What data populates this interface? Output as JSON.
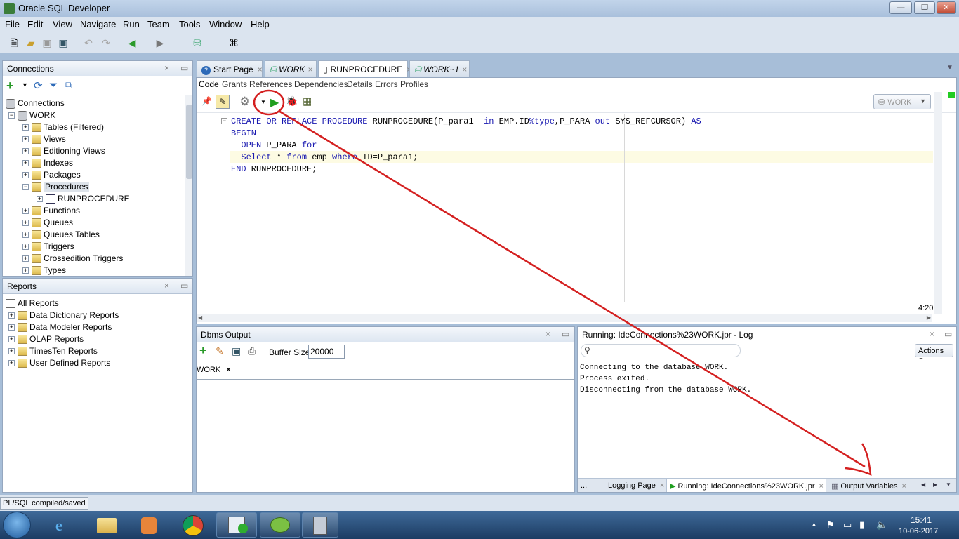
{
  "window": {
    "title": "Oracle SQL Developer"
  },
  "menu": [
    "File",
    "Edit",
    "View",
    "Navigate",
    "Run",
    "Team",
    "Tools",
    "Window",
    "Help"
  ],
  "connections": {
    "panel_title": "Connections",
    "root": "Connections",
    "connection": "WORK",
    "items": [
      "Tables (Filtered)",
      "Views",
      "Editioning Views",
      "Indexes",
      "Packages",
      "Procedures",
      "RUNPROCEDURE",
      "Functions",
      "Queues",
      "Queues Tables",
      "Triggers",
      "Crossedition Triggers",
      "Types"
    ]
  },
  "reports": {
    "panel_title": "Reports",
    "items": [
      "All Reports",
      "Data Dictionary Reports",
      "Data Modeler Reports",
      "OLAP Reports",
      "TimesTen Reports",
      "User Defined Reports"
    ]
  },
  "editor": {
    "tabs": [
      "Start Page",
      "WORK",
      "RUNPROCEDURE",
      "WORK~1"
    ],
    "subtabs": [
      "Code",
      "Grants",
      "References",
      "Dependencies",
      "Details",
      "Errors",
      "Profiles"
    ],
    "connection_selector": "WORK",
    "code": {
      "l1a": "CREATE OR REPLACE PROCEDURE",
      "l1b": " RUNPROCEDURE(P_para1  ",
      "l1c": "in",
      "l1d": " EMP.ID",
      "l1e": "%type",
      "l1f": ",P_PARA ",
      "l1g": "out",
      "l1h": " SYS_REFCURSOR) ",
      "l1i": "AS",
      "l2": "BEGIN",
      "l3a": "  OPEN",
      "l3b": " P_PARA ",
      "l3c": "for",
      "l4a": "  Select",
      "l4b": " * ",
      "l4c": "from",
      "l4d": " emp ",
      "l4e": "where",
      "l4f": " ID=P_para1;",
      "l5a": "END",
      "l5b": " RUNPROCEDURE;"
    },
    "cursor_position": "4:20"
  },
  "dbms_output": {
    "title": "Dbms Output",
    "buffer_label": "Buffer Size:",
    "buffer_value": "20000",
    "conn_tab": "WORK"
  },
  "log": {
    "title": "Running: IdeConnections%23WORK.jpr - Log",
    "actions_label": "Actions",
    "lines": [
      "Connecting to the database WORK.",
      "Process exited.",
      "Disconnecting from the database WORK."
    ],
    "bottom_tabs": [
      "...",
      "Logging Page",
      "Running: IdeConnections%23WORK.jpr",
      "Output Variables"
    ]
  },
  "status": {
    "text": "PL/SQL compiled/saved"
  },
  "taskbar": {
    "time": "15:41",
    "date": "10-06-2017"
  },
  "colors": {
    "annotation": "#d42020",
    "keyword": "#1818b0",
    "run_green": "#1f9e1f"
  }
}
